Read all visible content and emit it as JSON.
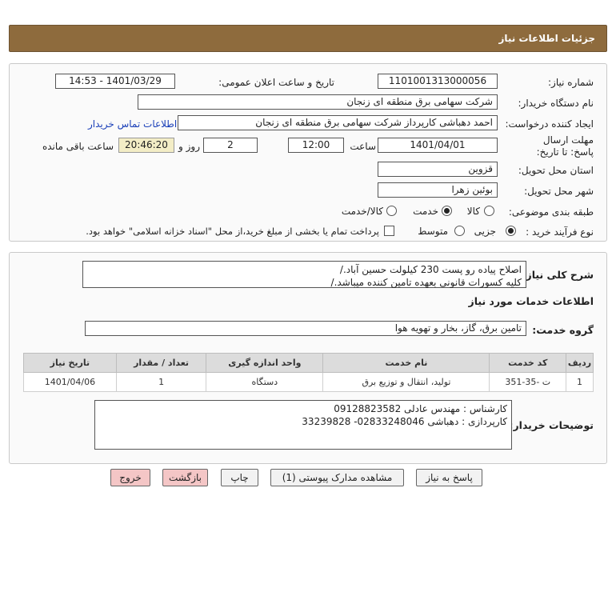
{
  "header": {
    "title": "جزئیات اطلاعات نیاز"
  },
  "fields": {
    "need_number_label": "شماره نیاز:",
    "need_number": "1101001313000056",
    "announce_label": "تاریخ و ساعت اعلان عمومی:",
    "announce_value": "1401/03/29 - 14:53",
    "buyer_org_label": "نام دستگاه خریدار:",
    "buyer_org": "شرکت سهامی برق منطقه ای زنجان",
    "creator_label": "ایجاد کننده درخواست:",
    "creator": "احمد دهباشی کارپرداز شرکت سهامی برق منطقه ای زنجان",
    "contact_link": "اطلاعات تماس خریدار",
    "deadline_label": "مهلت ارسال پاسخ: تا تاریخ:",
    "deadline_date": "1401/04/01",
    "time_label": "ساعت",
    "deadline_time": "12:00",
    "days_value": "2",
    "days_label": "روز و",
    "remaining_time": "20:46:20",
    "remaining_label": "ساعت باقی مانده",
    "province_label": "استان محل تحویل:",
    "province": "قزوین",
    "city_label": "شهر محل تحویل:",
    "city": "بوئین زهرا",
    "category_label": "طبقه بندی موضوعی:",
    "category_options": [
      "کالا",
      "خدمت",
      "کالا/خدمت"
    ],
    "purchase_type_label": "نوع فرآیند خرید :",
    "purchase_options": [
      "جزیی",
      "متوسط"
    ],
    "payment_note": "پرداخت تمام یا بخشی از مبلغ خرید،از محل \"اسناد خزانه اسلامی\" خواهد بود."
  },
  "description": {
    "label": "شرح کلی نیاز:",
    "line1": "اصلاح پیاده رو پست 230 کیلولت حسین آباد./",
    "line2": "کلیه کسورات قانونی بعهده تامین کننده میباشد./"
  },
  "services": {
    "section_title": "اطلاعات خدمات مورد نیاز",
    "group_label": "گروه خدمت:",
    "group_value": "تامین برق، گاز، بخار و تهویه هوا"
  },
  "table": {
    "headers": [
      "ردیف",
      "کد خدمت",
      "نام خدمت",
      "واحد اندازه گیری",
      "تعداد / مقدار",
      "تاریخ نیاز"
    ],
    "rows": [
      [
        "1",
        "ت -35-351",
        "تولید، انتقال و توزیع برق",
        "دستگاه",
        "1",
        "1401/04/06"
      ]
    ]
  },
  "buyer_notes": {
    "label": "توضیحات خریدار:",
    "line1": "کارشناس : مهندس عادلی 09128823582",
    "line2": "کارپردازی : دهباشی 02833248046- 33239828"
  },
  "buttons": {
    "reply": "پاسخ به نیاز",
    "docs": "مشاهده مدارک پیوستی (1)",
    "print": "چاپ",
    "back": "بازگشت",
    "exit": "خروج"
  },
  "colors": {
    "header_bg": "#8e6b3d",
    "remaining_bg": "#f3edc6",
    "link": "#1a3fb8",
    "exit_bg": "#f4c6c6"
  }
}
